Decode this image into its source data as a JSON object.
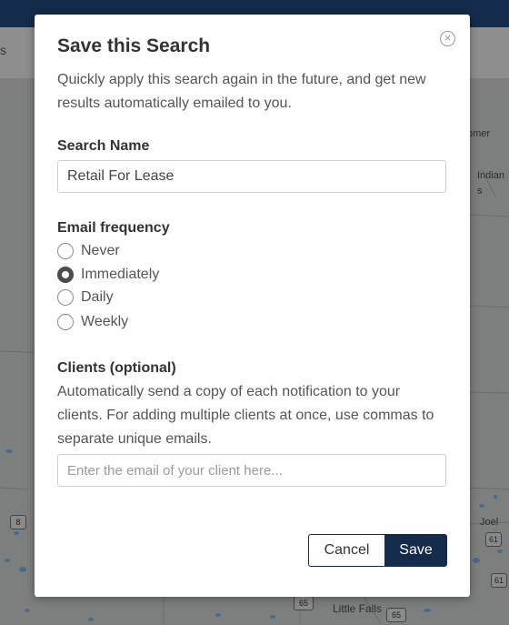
{
  "background": {
    "subbar_text": "s",
    "map_labels": {
      "elmer": "omer",
      "indian": "Indian",
      "is": "s",
      "joel": "Joel",
      "little_falls": "Little Falls"
    },
    "shields": [
      "8",
      "61",
      "65",
      "65",
      "61"
    ]
  },
  "modal": {
    "title": "Save this Search",
    "close_icon": "close-circle-icon",
    "subtitle": "Quickly apply this search again in the future, and get new results automatically emailed to you.",
    "search_name": {
      "label": "Search Name",
      "value": "Retail For Lease"
    },
    "email_frequency": {
      "label": "Email frequency",
      "options": [
        "Never",
        "Immediately",
        "Daily",
        "Weekly"
      ],
      "selected": "Immediately"
    },
    "clients": {
      "label": "Clients (optional)",
      "help": "Automatically send a copy of each notification to your clients. For adding multiple clients at once, use commas to separate unique emails.",
      "placeholder": "Enter the email of your client here...",
      "value": ""
    },
    "buttons": {
      "cancel": "Cancel",
      "save": "Save"
    }
  },
  "colors": {
    "navy": "#142b4c",
    "overlay": "#7d7f7f"
  }
}
